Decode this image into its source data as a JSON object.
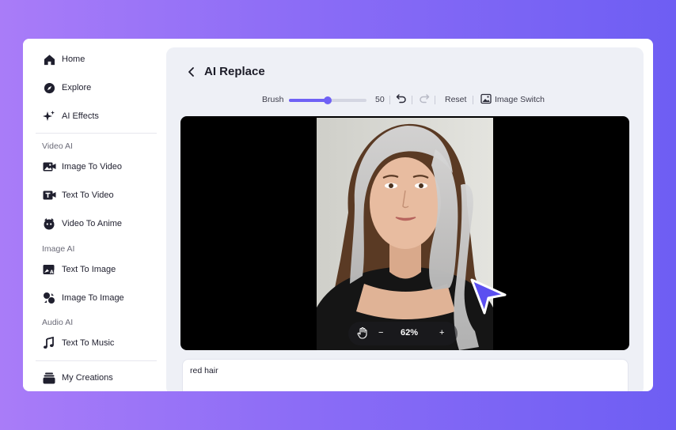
{
  "sidebar": {
    "items": [
      {
        "label": "Home",
        "icon": "home-icon"
      },
      {
        "label": "Explore",
        "icon": "compass-icon"
      },
      {
        "label": "AI Effects",
        "icon": "sparkle-icon"
      },
      {
        "label": "Image To Video",
        "icon": "image-video-icon"
      },
      {
        "label": "Text To Video",
        "icon": "text-video-icon"
      },
      {
        "label": "Video To Anime",
        "icon": "anime-icon"
      },
      {
        "label": "Text To Image",
        "icon": "text-image-icon"
      },
      {
        "label": "Image To Image",
        "icon": "image-image-icon"
      },
      {
        "label": "Text To Music",
        "icon": "music-icon"
      },
      {
        "label": "My Creations",
        "icon": "creations-icon"
      }
    ],
    "sections": {
      "video": "Video AI",
      "image": "Image AI",
      "audio": "Audio AI"
    }
  },
  "header": {
    "title": "AI Replace"
  },
  "toolbar": {
    "brush_label": "Brush",
    "brush_value": "50",
    "brush_fraction": 0.5,
    "reset_label": "Reset",
    "image_switch_label": "Image Switch"
  },
  "zoom": {
    "minus": "−",
    "level": "62%",
    "plus": "+"
  },
  "prompt": {
    "value": "red hair"
  },
  "colors": {
    "accent": "#6f61f5",
    "background_gradient_start": "#a97cf8",
    "background_gradient_end": "#6e5ef3"
  }
}
